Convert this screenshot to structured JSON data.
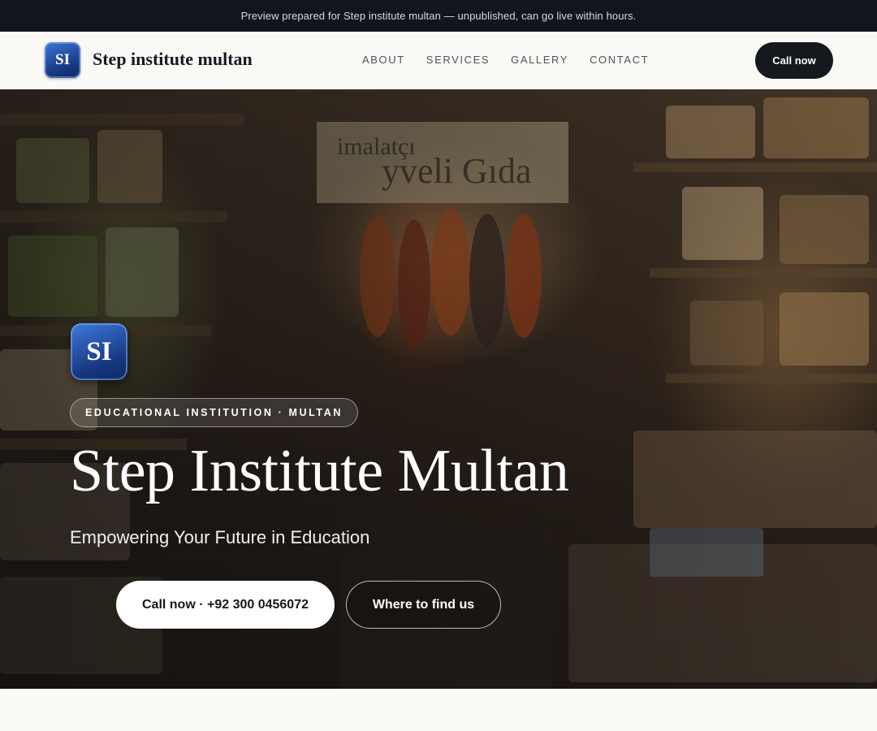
{
  "preview_banner": "Preview prepared for Step institute multan — unpublished, can go live within hours.",
  "header": {
    "logo_initials": "SI",
    "brand_name": "Step institute multan",
    "nav": [
      "ABOUT",
      "SERVICES",
      "GALLERY",
      "CONTACT"
    ],
    "cta_label": "Call now"
  },
  "hero": {
    "logo_initials": "SI",
    "badge": "EDUCATIONAL INSTITUTION · MULTAN",
    "title": "Step Institute Multan",
    "subtitle": "Empowering Your Future in Education",
    "primary_cta": "Call now · +92 300 0456072",
    "secondary_cta": "Where to find us",
    "background_sign_text": "imalatçı yveli Gıda"
  },
  "colors": {
    "dark": "#15181d",
    "banner_bg": "#12161c",
    "page_bg": "#faf9f6",
    "logo_blue": "#16377f"
  }
}
